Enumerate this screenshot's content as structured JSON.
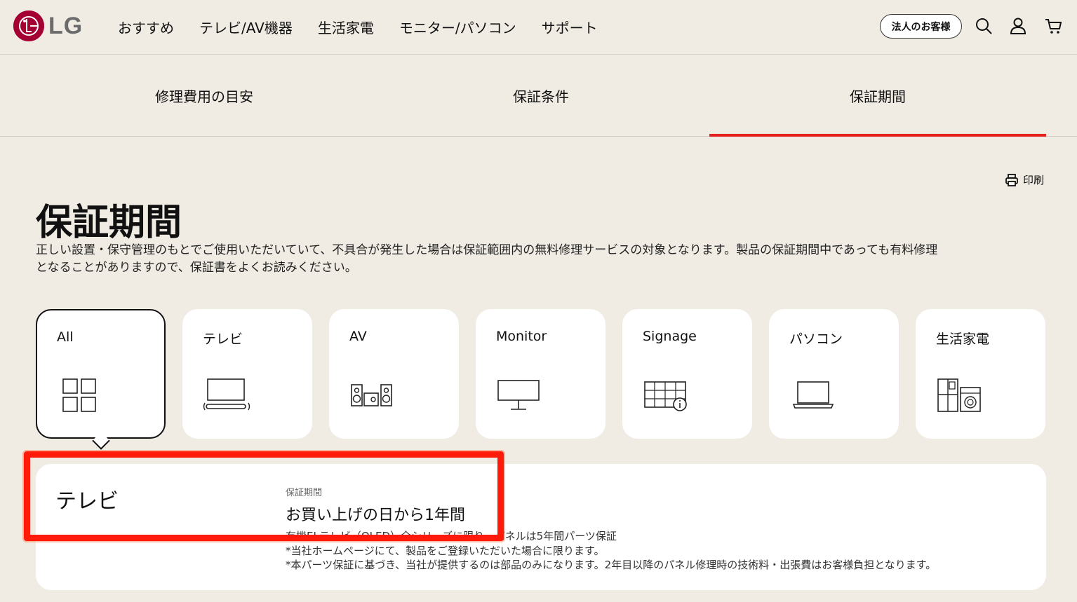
{
  "header": {
    "logo_text": "LG",
    "nav": [
      "おすすめ",
      "テレビ/AV機器",
      "生活家電",
      "モニター/パソコン",
      "サポート"
    ],
    "business_button": "法人のお客様"
  },
  "tabs": [
    {
      "label": "修理費用の目安",
      "active": false
    },
    {
      "label": "保証条件",
      "active": false
    },
    {
      "label": "保証期間",
      "active": true
    }
  ],
  "print_label": "印刷",
  "page_title": "保証期間",
  "description_line1": "正しい設置・保守管理のもとでご使用いただいていて、不具合が発生した場合は保証範囲内の無料修理サービスの対象となります。製品の保証期間中であっても有料修理",
  "description_line2": "となることがありますので、保証書をよくお読みください。",
  "categories": [
    {
      "label": "All",
      "icon": "grid-icon",
      "active": true
    },
    {
      "label": "テレビ",
      "icon": "tv-icon",
      "active": false
    },
    {
      "label": "AV",
      "icon": "speaker-icon",
      "active": false
    },
    {
      "label": "Monitor",
      "icon": "monitor-icon",
      "active": false
    },
    {
      "label": "Signage",
      "icon": "signage-icon",
      "active": false
    },
    {
      "label": "パソコン",
      "icon": "laptop-icon",
      "active": false
    },
    {
      "label": "生活家電",
      "icon": "appliance-icon",
      "active": false
    }
  ],
  "detail": {
    "name": "テレビ",
    "period_label": "保証期間",
    "period_value": "お買い上げの日から1年間",
    "notes": [
      "有機ELテレビ（OLED）全シリーズに限り、パネルは5年間パーツ保証",
      "*当社ホームページにて、製品をご登録いただいた場合に限ります。",
      "*本パーツ保証に基づき、当社が提供するのは部品のみになります。2年目以降のパネル修理時の技術料・出張費はお客様負担となります。"
    ]
  },
  "colors": {
    "accent_red": "#e4211c",
    "lg_red": "#a50034",
    "background": "#f0ece4"
  }
}
